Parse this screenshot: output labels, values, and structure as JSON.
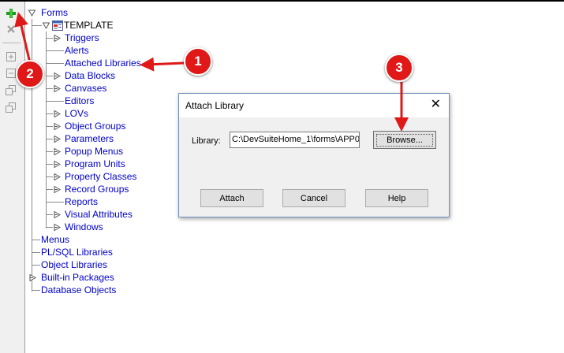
{
  "toolbar": {
    "buttons": [
      {
        "icon": "plus-create-icon",
        "symbol": "+"
      },
      {
        "icon": "delete-x-icon",
        "symbol": "×"
      },
      {
        "icon": "expand-icon",
        "symbol": "+"
      },
      {
        "icon": "collapse-icon",
        "symbol": "−"
      },
      {
        "icon": "expand-all-icon",
        "symbol": ""
      },
      {
        "icon": "collapse-all-icon",
        "symbol": ""
      }
    ]
  },
  "tree": {
    "root": "Forms",
    "module": "TEMPLATE",
    "children": [
      "Triggers",
      "Alerts",
      "Attached Libraries",
      "Data Blocks",
      "Canvases",
      "Editors",
      "LOVs",
      "Object Groups",
      "Parameters",
      "Popup Menus",
      "Program Units",
      "Property Classes",
      "Record Groups",
      "Reports",
      "Visual Attributes",
      "Windows"
    ],
    "top_level": [
      "Menus",
      "PL/SQL Libraries",
      "Object Libraries",
      "Built-in Packages",
      "Database Objects"
    ]
  },
  "dialog": {
    "title": "Attach Library",
    "close_symbol": "✕",
    "library_label": "Library:",
    "library_value": "C:\\DevSuiteHome_1\\forms\\APP0",
    "browse_label": "Browse...",
    "attach_label": "Attach",
    "cancel_label": "Cancel",
    "help_label": "Help"
  },
  "annotations": {
    "badge_1": "1",
    "badge_2": "2",
    "badge_3": "3",
    "color": "#e01818"
  }
}
